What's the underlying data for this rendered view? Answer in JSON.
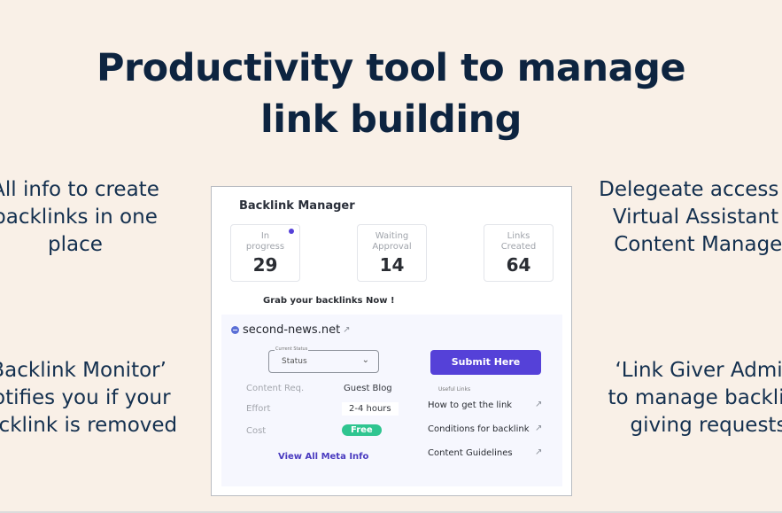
{
  "headline": {
    "line1": "Productivity tool to manage",
    "line2": "link building"
  },
  "features": {
    "top_left": [
      "All info to create",
      "backlinks in one",
      "place"
    ],
    "bottom_left": [
      "‘Backlink Monitor’",
      "notifies you if your",
      "backlink is removed"
    ],
    "top_right": [
      "Delegeate access to",
      "Virtual Assistant /",
      "Content Manager"
    ],
    "bottom_right": [
      "‘Link Giver Admin’",
      "to manage backlink",
      "giving requests"
    ]
  },
  "panel": {
    "title": "Backlink Manager",
    "stats": [
      {
        "label1": "In",
        "label2": "progress",
        "value": "29",
        "has_dot": true
      },
      {
        "label1": "Waiting",
        "label2": "Approval",
        "value": "14"
      },
      {
        "label1": "Links",
        "label2": "Created",
        "value": "64"
      }
    ],
    "grab_text": "Grab your backlinks Now !",
    "site": "second-news.net",
    "status_select": {
      "legend": "Current Status",
      "value": "Status"
    },
    "submit_label": "Submit Here",
    "meta": [
      {
        "label": "Content Req.",
        "value": "Guest Blog"
      },
      {
        "label": "Effort",
        "value": "2-4 hours"
      },
      {
        "label": "Cost",
        "value": "Free"
      }
    ],
    "view_all_label": "View All Meta Info",
    "useful_links_title": "Useful Links",
    "useful_links": [
      "How to get the link",
      "Conditions for backlink",
      "Content Guidelines"
    ]
  },
  "icons": {
    "external": "↗",
    "chevron": "⌄"
  },
  "colors": {
    "accent": "#5541d8",
    "free_badge": "#2fc590",
    "background": "#f9f0e7",
    "headline": "#0d2440"
  }
}
